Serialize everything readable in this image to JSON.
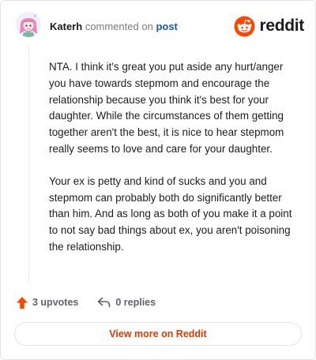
{
  "header": {
    "author": "Katerh",
    "action_text": "commented on",
    "post_link": "post",
    "brand_name": "reddit"
  },
  "comment": {
    "paragraphs": [
      "NTA. I think it's great you put aside any hurt/anger you have towards stepmom and encourage the relationship because you think it's best for your daughter. While the circumstances of them getting together aren't the best, it is nice to hear stepmom really seems to love and care for your daughter.",
      "Your ex is petty and kind of sucks and you and stepmom can probably both do significantly better than him. And as long as both of you make it a point to not say bad things about ex, you aren't poisoning the relationship."
    ]
  },
  "actions": {
    "upvotes": "3 upvotes",
    "replies": "0 replies",
    "upvote_icon": "upvote-arrow-icon",
    "reply_icon": "reply-arrow-icon"
  },
  "footer": {
    "view_more_label": "View more on Reddit"
  },
  "colors": {
    "brand_orange": "#ff4500",
    "link_blue": "#1c5aa8",
    "view_more_text": "#d93a00"
  }
}
